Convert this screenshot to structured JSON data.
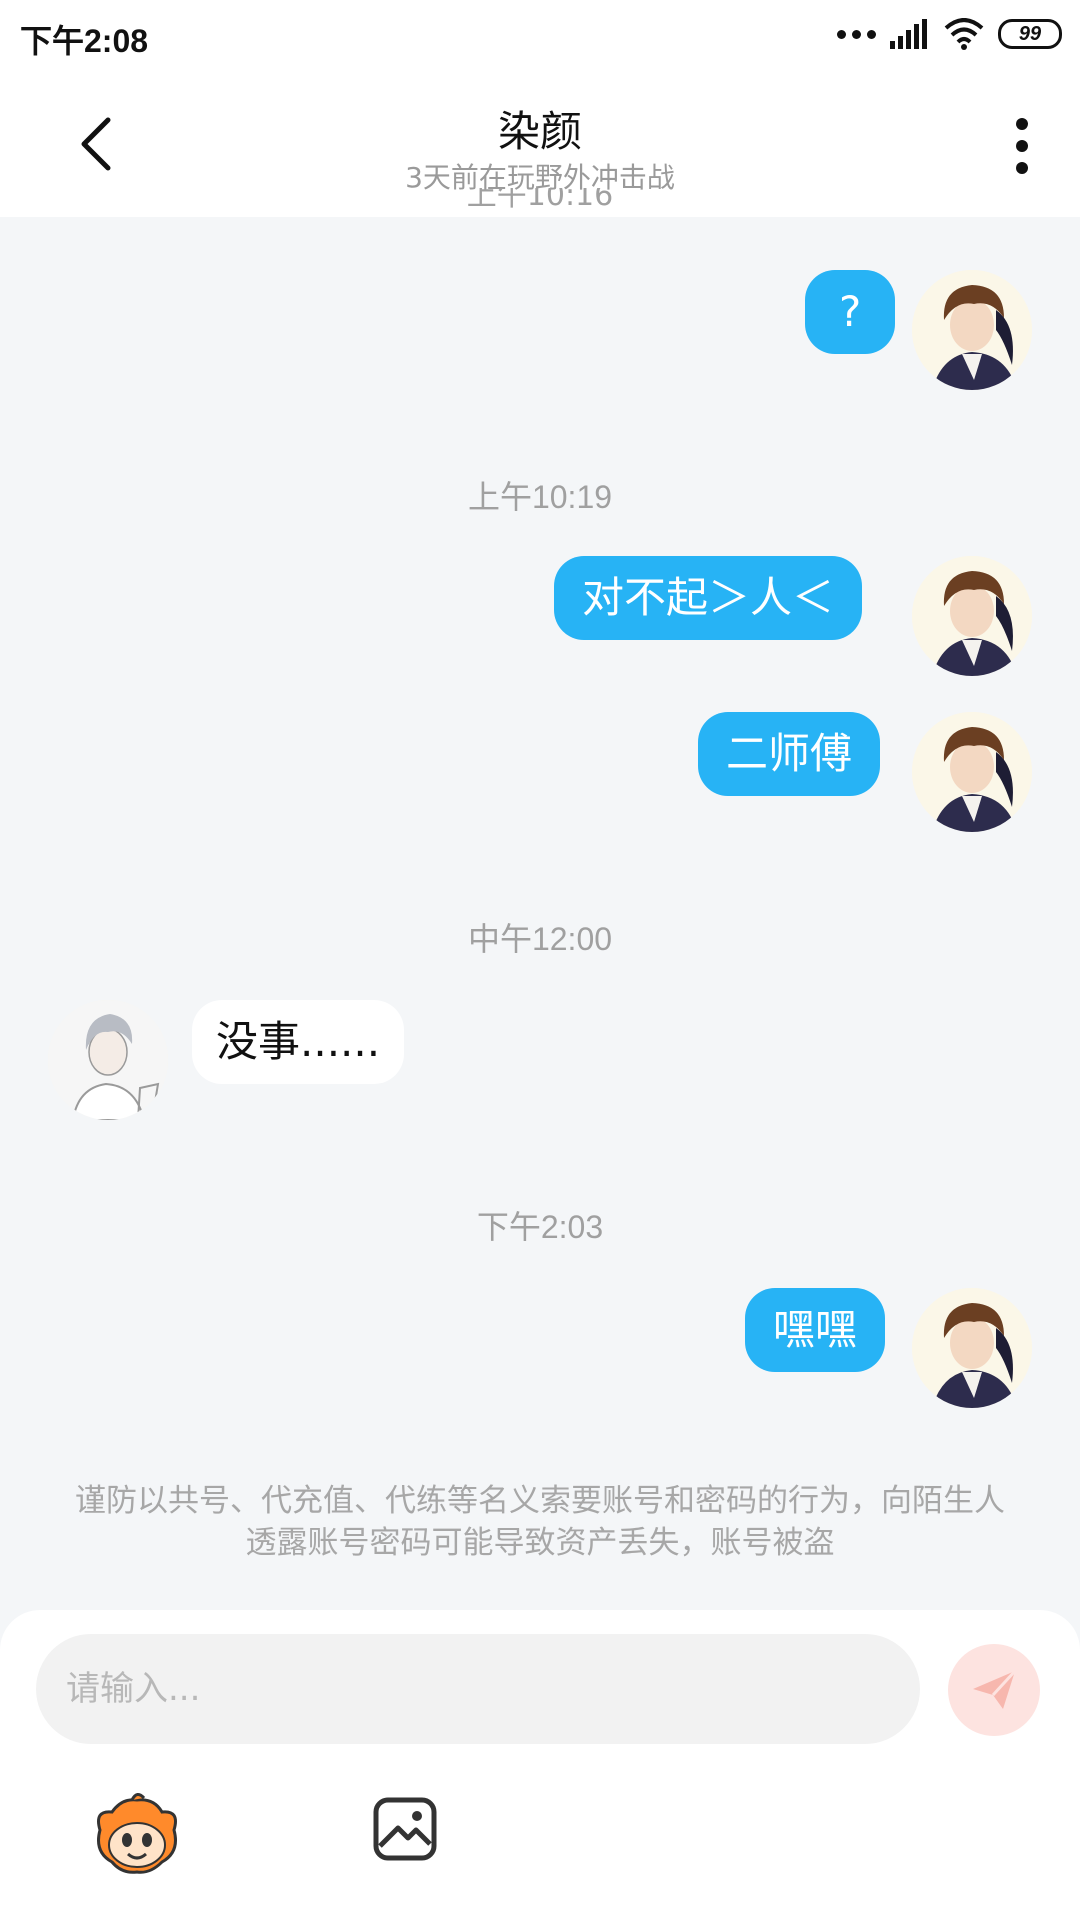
{
  "status_bar": {
    "time": "下午2:08",
    "battery": "99"
  },
  "header": {
    "title": "染颜",
    "subtitle": "3天前在玩野外冲击战"
  },
  "chat": {
    "cut_timestamp": "上午10:16",
    "timestamps": [
      "上午10:19",
      "中午12:00",
      "下午2:03"
    ],
    "messages": [
      {
        "from": "me",
        "text": "?"
      },
      {
        "from": "me",
        "text": "对不起＞人＜"
      },
      {
        "from": "me",
        "text": "二师傅"
      },
      {
        "from": "them",
        "text": "没事......"
      },
      {
        "from": "me",
        "text": "嘿嘿"
      }
    ]
  },
  "notice": "谨防以共号、代充值、代练等名义索要账号和密码的行为，向陌生人透露账号密码可能导致资产丢失，账号被盗",
  "input": {
    "placeholder": "请输入..."
  },
  "colors": {
    "bubble_out": "#27b3f5",
    "send_button": "#fde3e0",
    "background": "#f4f6f8"
  },
  "icons": [
    "back-arrow-icon",
    "more-vertical-icon",
    "send-icon",
    "emoji-mascot-icon",
    "image-icon",
    "wifi-icon",
    "signal-icon"
  ]
}
